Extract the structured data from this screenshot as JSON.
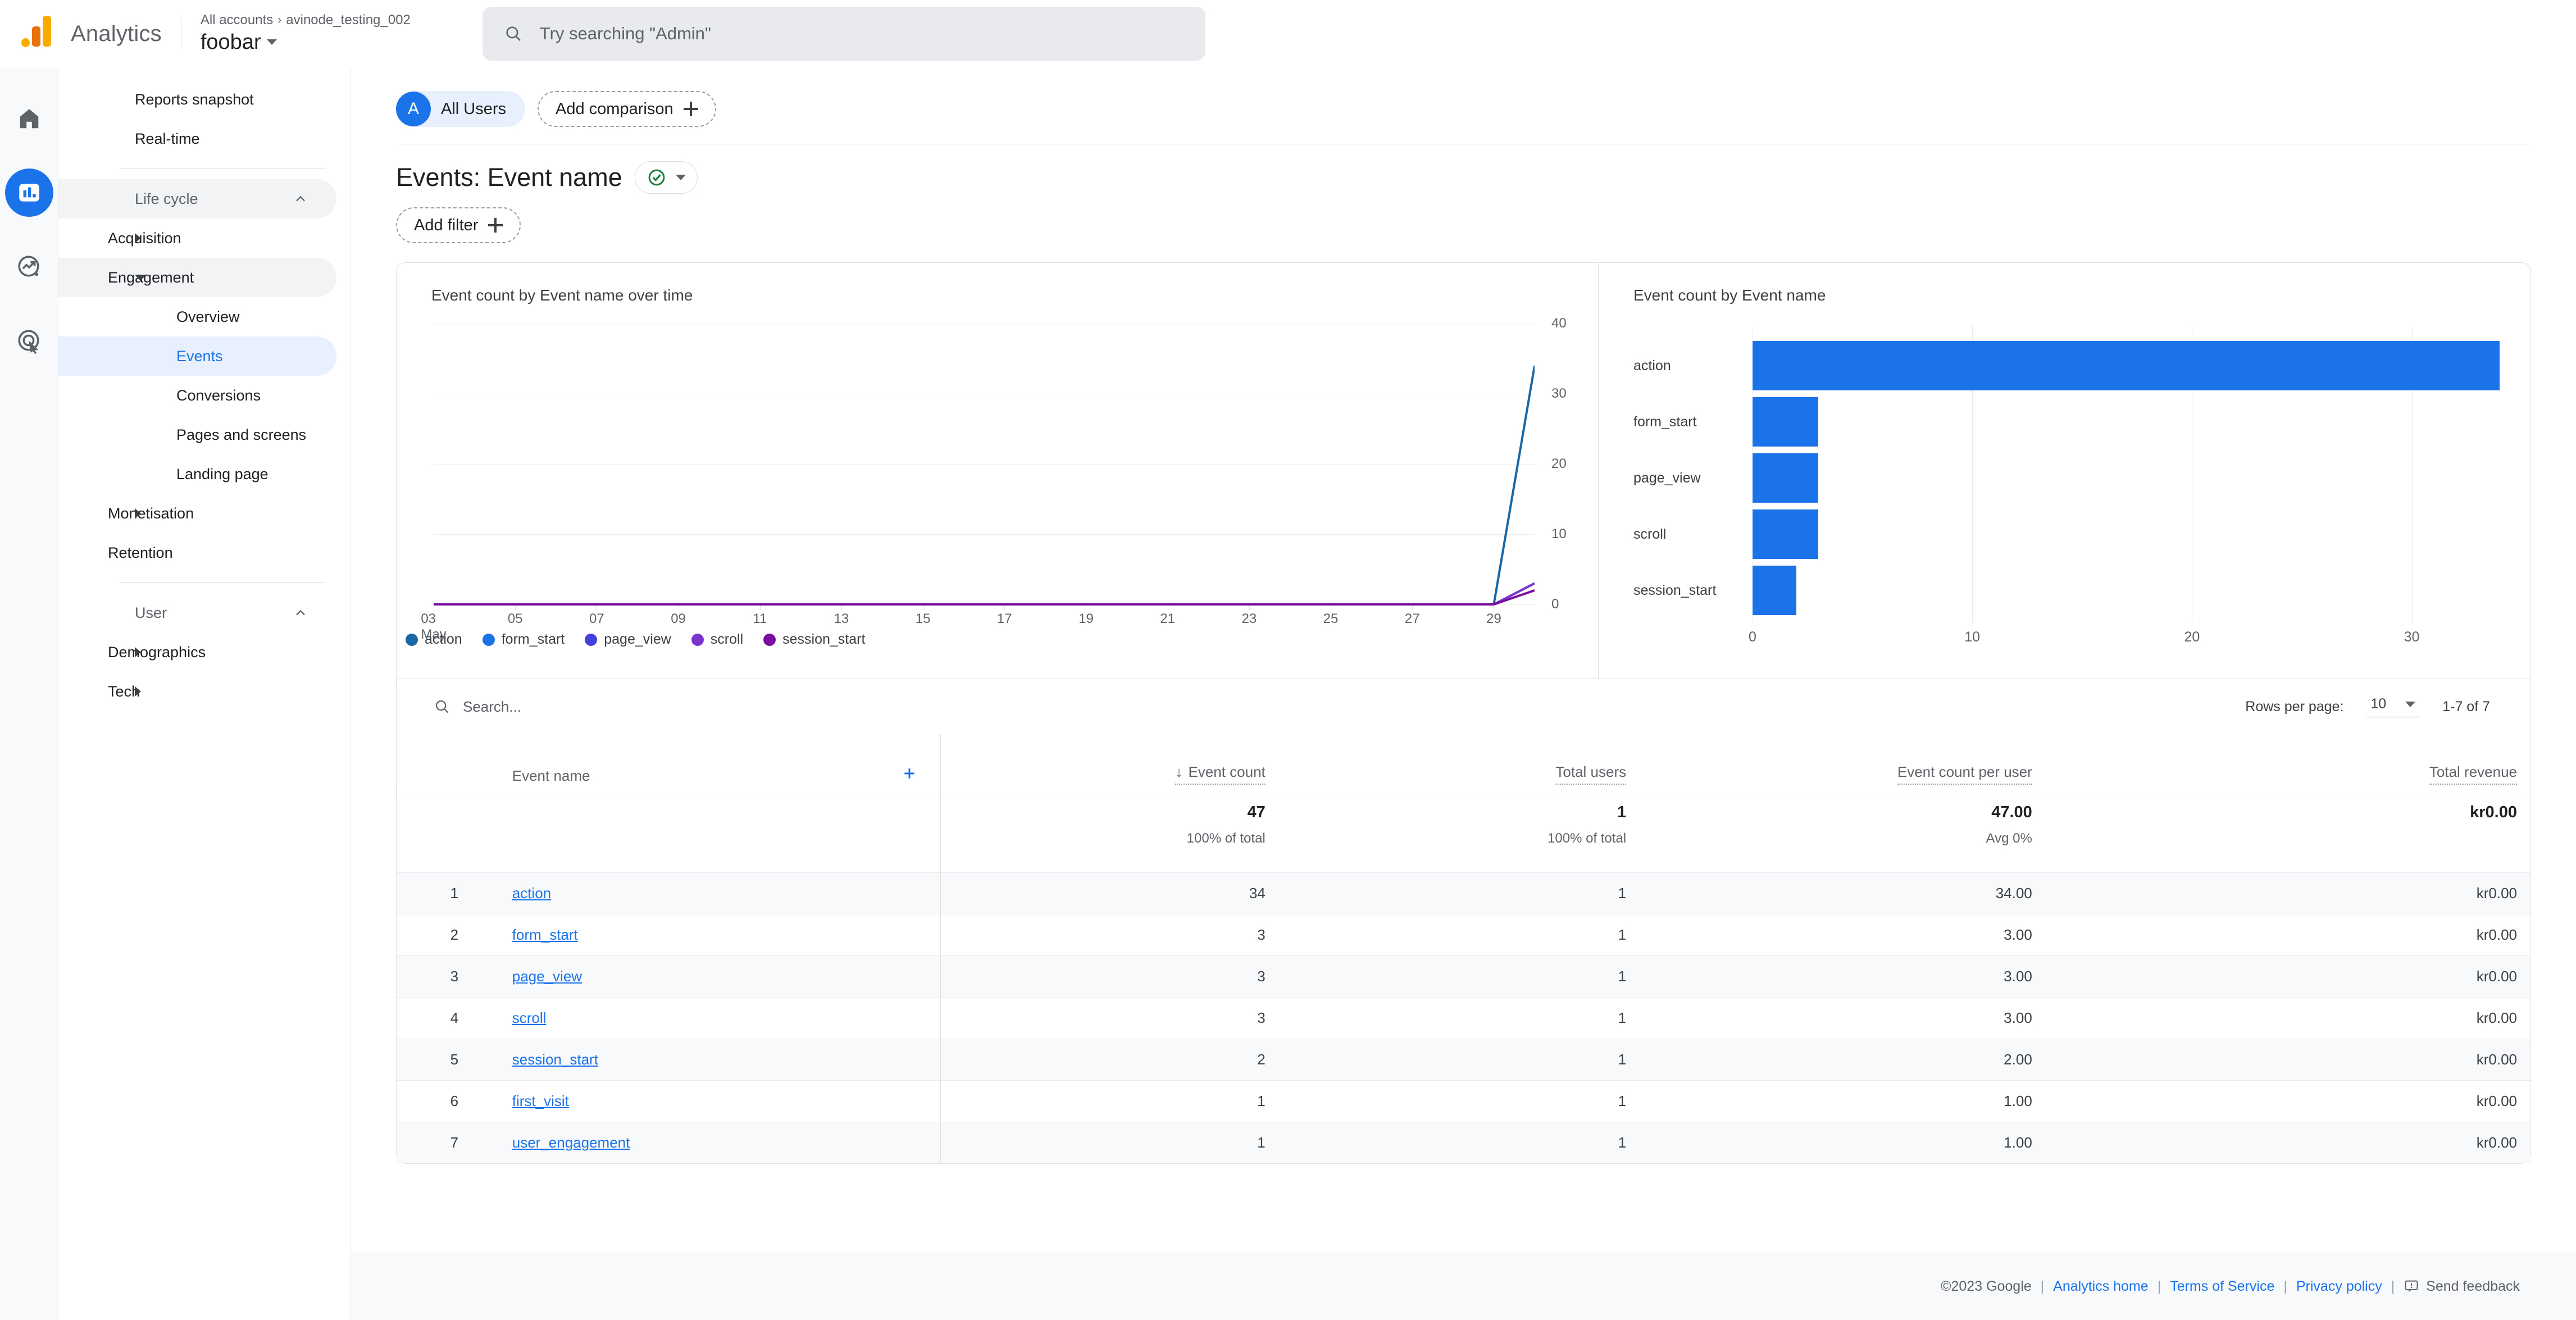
{
  "header": {
    "logo_name": "analytics-logo",
    "brand": "Analytics",
    "breadcrumb_accounts": "All accounts",
    "breadcrumb_sep": "›",
    "breadcrumb_account": "avinode_testing_002",
    "property": "foobar",
    "search_placeholder": "Try searching \"Admin\""
  },
  "rail": {
    "items": [
      {
        "name": "home-icon",
        "label": "Home",
        "active": false
      },
      {
        "name": "reports-icon",
        "label": "Reports",
        "active": true
      },
      {
        "name": "explore-icon",
        "label": "Explore",
        "active": false
      },
      {
        "name": "advertising-icon",
        "label": "Advertising",
        "active": false
      }
    ]
  },
  "sidebar": {
    "top_items": [
      {
        "label": "Reports snapshot"
      },
      {
        "label": "Real-time"
      }
    ],
    "groups": [
      {
        "label": "Life cycle",
        "items": [
          {
            "label": "Acquisition",
            "expandable": true,
            "expanded": false
          },
          {
            "label": "Engagement",
            "expandable": true,
            "expanded": true,
            "hilite": true
          },
          {
            "label": "Overview",
            "sub": true
          },
          {
            "label": "Events",
            "sub": true,
            "selected": true
          },
          {
            "label": "Conversions",
            "sub": true
          },
          {
            "label": "Pages and screens",
            "sub": true
          },
          {
            "label": "Landing page",
            "sub": true
          },
          {
            "label": "Monetisation",
            "expandable": true,
            "expanded": false
          },
          {
            "label": "Retention"
          }
        ]
      },
      {
        "label": "User",
        "items": [
          {
            "label": "Demographics",
            "expandable": true,
            "expanded": false
          },
          {
            "label": "Tech",
            "expandable": true,
            "expanded": false
          }
        ]
      }
    ]
  },
  "controls": {
    "all_users_initial": "A",
    "all_users_label": "All Users",
    "add_comparison_label": "Add comparison",
    "add_filter_label": "Add filter"
  },
  "page": {
    "title": "Events: Event name",
    "status_icon": "check-circle-icon"
  },
  "chart_data": [
    {
      "type": "line",
      "title": "Event count by Event name over time",
      "xlabel": "",
      "ylabel": "",
      "ylim": [
        0,
        40
      ],
      "yticks": [
        0,
        10,
        20,
        30,
        40
      ],
      "grid": true,
      "legend_position": "bottom",
      "x": [
        "03",
        "04",
        "05",
        "06",
        "07",
        "08",
        "09",
        "10",
        "11",
        "12",
        "13",
        "14",
        "15",
        "16",
        "17",
        "18",
        "19",
        "20",
        "21",
        "22",
        "23",
        "24",
        "25",
        "26",
        "27",
        "28",
        "29",
        "30"
      ],
      "xtick_labels": [
        "03",
        "05",
        "07",
        "09",
        "11",
        "13",
        "15",
        "17",
        "19",
        "21",
        "23",
        "25",
        "27",
        "29"
      ],
      "x_axis_month": "May",
      "series": [
        {
          "name": "action",
          "color": "#1967A5",
          "values": [
            0,
            0,
            0,
            0,
            0,
            0,
            0,
            0,
            0,
            0,
            0,
            0,
            0,
            0,
            0,
            0,
            0,
            0,
            0,
            0,
            0,
            0,
            0,
            0,
            0,
            0,
            0,
            34
          ]
        },
        {
          "name": "form_start",
          "color": "#1A73E8",
          "values": [
            0,
            0,
            0,
            0,
            0,
            0,
            0,
            0,
            0,
            0,
            0,
            0,
            0,
            0,
            0,
            0,
            0,
            0,
            0,
            0,
            0,
            0,
            0,
            0,
            0,
            0,
            0,
            3
          ]
        },
        {
          "name": "page_view",
          "color": "#4340DB",
          "values": [
            0,
            0,
            0,
            0,
            0,
            0,
            0,
            0,
            0,
            0,
            0,
            0,
            0,
            0,
            0,
            0,
            0,
            0,
            0,
            0,
            0,
            0,
            0,
            0,
            0,
            0,
            0,
            3
          ]
        },
        {
          "name": "scroll",
          "color": "#7B35CC",
          "values": [
            0,
            0,
            0,
            0,
            0,
            0,
            0,
            0,
            0,
            0,
            0,
            0,
            0,
            0,
            0,
            0,
            0,
            0,
            0,
            0,
            0,
            0,
            0,
            0,
            0,
            0,
            0,
            3
          ]
        },
        {
          "name": "session_start",
          "color": "#7B0D9E",
          "values": [
            0,
            0,
            0,
            0,
            0,
            0,
            0,
            0,
            0,
            0,
            0,
            0,
            0,
            0,
            0,
            0,
            0,
            0,
            0,
            0,
            0,
            0,
            0,
            0,
            0,
            0,
            0,
            2
          ]
        }
      ]
    },
    {
      "type": "bar",
      "orientation": "horizontal",
      "title": "Event count by Event name",
      "categories": [
        "action",
        "form_start",
        "page_view",
        "scroll",
        "session_start"
      ],
      "values": [
        34,
        3,
        3,
        3,
        2
      ],
      "bar_color": "#1A73E8",
      "xlim": [
        0,
        34
      ],
      "xticks": [
        0,
        10,
        20,
        30
      ],
      "xlabel": "",
      "ylabel": "",
      "grid": true
    }
  ],
  "table": {
    "search_placeholder": "Search...",
    "rows_per_page_label": "Rows per page:",
    "rows_per_page_value": "10",
    "range_label": "1-7 of 7",
    "columns": [
      {
        "key": "index",
        "label": ""
      },
      {
        "key": "event_name",
        "label": "Event name",
        "sorted": false
      },
      {
        "key": "event_count",
        "label": "Event count",
        "sorted": true,
        "sort_dir": "desc"
      },
      {
        "key": "total_users",
        "label": "Total users",
        "sorted": false
      },
      {
        "key": "event_count_per_user",
        "label": "Event count per user",
        "sorted": false
      },
      {
        "key": "total_revenue",
        "label": "Total revenue",
        "sorted": false
      }
    ],
    "totals": {
      "event_count": "47",
      "event_count_sub": "100% of total",
      "total_users": "1",
      "total_users_sub": "100% of total",
      "event_count_per_user": "47.00",
      "event_count_per_user_sub": "Avg 0%",
      "total_revenue": "kr0.00",
      "total_revenue_sub": ""
    },
    "rows": [
      {
        "index": "1",
        "event_name": "action",
        "event_count": "34",
        "total_users": "1",
        "event_count_per_user": "34.00",
        "total_revenue": "kr0.00"
      },
      {
        "index": "2",
        "event_name": "form_start",
        "event_count": "3",
        "total_users": "1",
        "event_count_per_user": "3.00",
        "total_revenue": "kr0.00"
      },
      {
        "index": "3",
        "event_name": "page_view",
        "event_count": "3",
        "total_users": "1",
        "event_count_per_user": "3.00",
        "total_revenue": "kr0.00"
      },
      {
        "index": "4",
        "event_name": "scroll",
        "event_count": "3",
        "total_users": "1",
        "event_count_per_user": "3.00",
        "total_revenue": "kr0.00"
      },
      {
        "index": "5",
        "event_name": "session_start",
        "event_count": "2",
        "total_users": "1",
        "event_count_per_user": "2.00",
        "total_revenue": "kr0.00"
      },
      {
        "index": "6",
        "event_name": "first_visit",
        "event_count": "1",
        "total_users": "1",
        "event_count_per_user": "1.00",
        "total_revenue": "kr0.00"
      },
      {
        "index": "7",
        "event_name": "user_engagement",
        "event_count": "1",
        "total_users": "1",
        "event_count_per_user": "1.00",
        "total_revenue": "kr0.00"
      }
    ]
  },
  "footer": {
    "copyright": "©2023 Google",
    "links": [
      "Analytics home",
      "Terms of Service",
      "Privacy policy"
    ],
    "feedback_label": "Send feedback"
  },
  "colors": {
    "accent": "#1A73E8",
    "selected_bg": "#E8F0FE",
    "page_bg": "#FFFFFF",
    "rail_bg": "#F8F9FA",
    "check_green": "#188038"
  }
}
